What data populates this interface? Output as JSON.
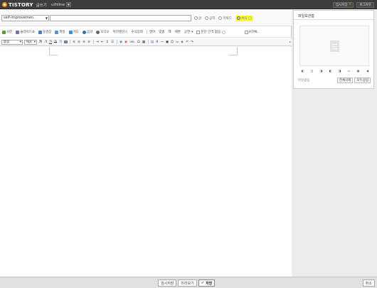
{
  "topbar": {
    "brand": "TISTORY",
    "subtitle": "글쓰기",
    "blog_name": "uthline",
    "temp_saved_label": "임시저장",
    "temp_saved_count": "0",
    "logout_label": "로그아웃"
  },
  "editor": {
    "category_value": "self-improvemen..",
    "title_value": "",
    "visibility": {
      "options": [
        "글",
        "공지",
        "키워드",
        "서식"
      ],
      "selected": "서식"
    },
    "insert_bar": {
      "items": [
        "사진",
        "슬라이드쇼",
        "동영상",
        "파일",
        "지도",
        "음악",
        "오디오",
        "위치멘션스",
        "수식입력",
        "영어",
        "맞춤",
        "책",
        "애완",
        "공연"
      ],
      "linebreak_label": "문단 간격 없음",
      "html_label": "HTML"
    },
    "format_bar": {
      "font_value": "돋움",
      "size_value": "9pt",
      "buttons": [
        "가",
        "가",
        "가",
        "가",
        "가"
      ]
    }
  },
  "side": {
    "title": "파일보관함",
    "status": "파일없음",
    "delete_all_label": "전체삭제",
    "insert_all_label": "모두삽입"
  },
  "bottom": {
    "temp_save_label": "임시저장",
    "preview_label": "미리보기",
    "save_label": "저장",
    "cancel_label": "취소"
  },
  "colors": {
    "topbar_bg": "#3d3d3d",
    "brand_orange": "#f28c28",
    "highlight": "#ffff33"
  }
}
